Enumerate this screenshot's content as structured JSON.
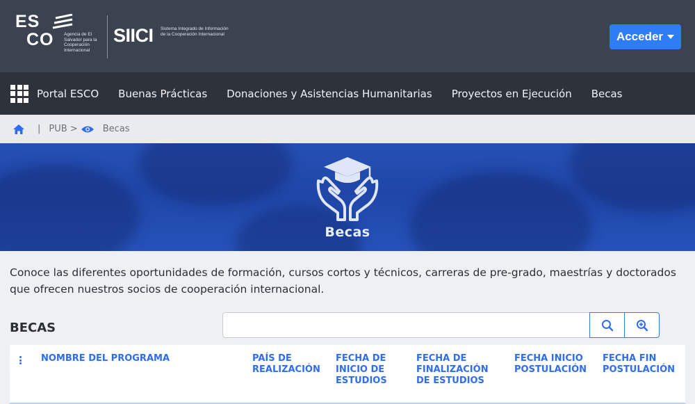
{
  "header": {
    "esco_line1": "ES",
    "esco_line2": "CO",
    "esco_subtitle": "Agencia de El Salvador para la Cooperación Internacional",
    "siici_name": "SIICI",
    "siici_subtitle": "Sistema Integrado de Información de la Cooperación Internacional",
    "login_label": "Acceder"
  },
  "nav": {
    "items": [
      {
        "label": "Portal ESCO"
      },
      {
        "label": "Buenas Prácticas"
      },
      {
        "label": "Donaciones y Asistencias Humanitarias"
      },
      {
        "label": "Proyectos en Ejecución"
      },
      {
        "label": "Becas"
      }
    ]
  },
  "breadcrumb": {
    "separator": "|",
    "pub": "PUB >",
    "current": "Becas"
  },
  "banner": {
    "title": "Becas"
  },
  "content": {
    "intro": "Conoce las diferentes oportunidades de formación, cursos cortos y técnicos, carreras de pre-grado, maestrías y doctorados que ofrecen nuestros socios de cooperación internacional.",
    "section_title": "BECAS",
    "search_value": ""
  },
  "table": {
    "columns": [
      {
        "label": "NOMBRE DEL PROGRAMA"
      },
      {
        "label": "PAÍS DE REALIZACIÓN"
      },
      {
        "label": "FECHA DE INICIO DE ESTUDIOS"
      },
      {
        "label": "FECHA DE FINALIZACIÓN DE ESTUDIOS"
      },
      {
        "label": "FECHA INICIO POSTULACIÓN"
      },
      {
        "label": "FECHA FIN POSTULACIÓN"
      }
    ]
  },
  "colors": {
    "header_bg": "#3c4350",
    "nav_bg": "#2e333b",
    "accent": "#2f7df6",
    "banner": "#2651b5"
  },
  "icons": [
    "apps-grid-icon",
    "home-icon",
    "eye-icon",
    "graduation-hands-icon",
    "search-icon",
    "zoom-in-icon",
    "column-menu-icon"
  ]
}
